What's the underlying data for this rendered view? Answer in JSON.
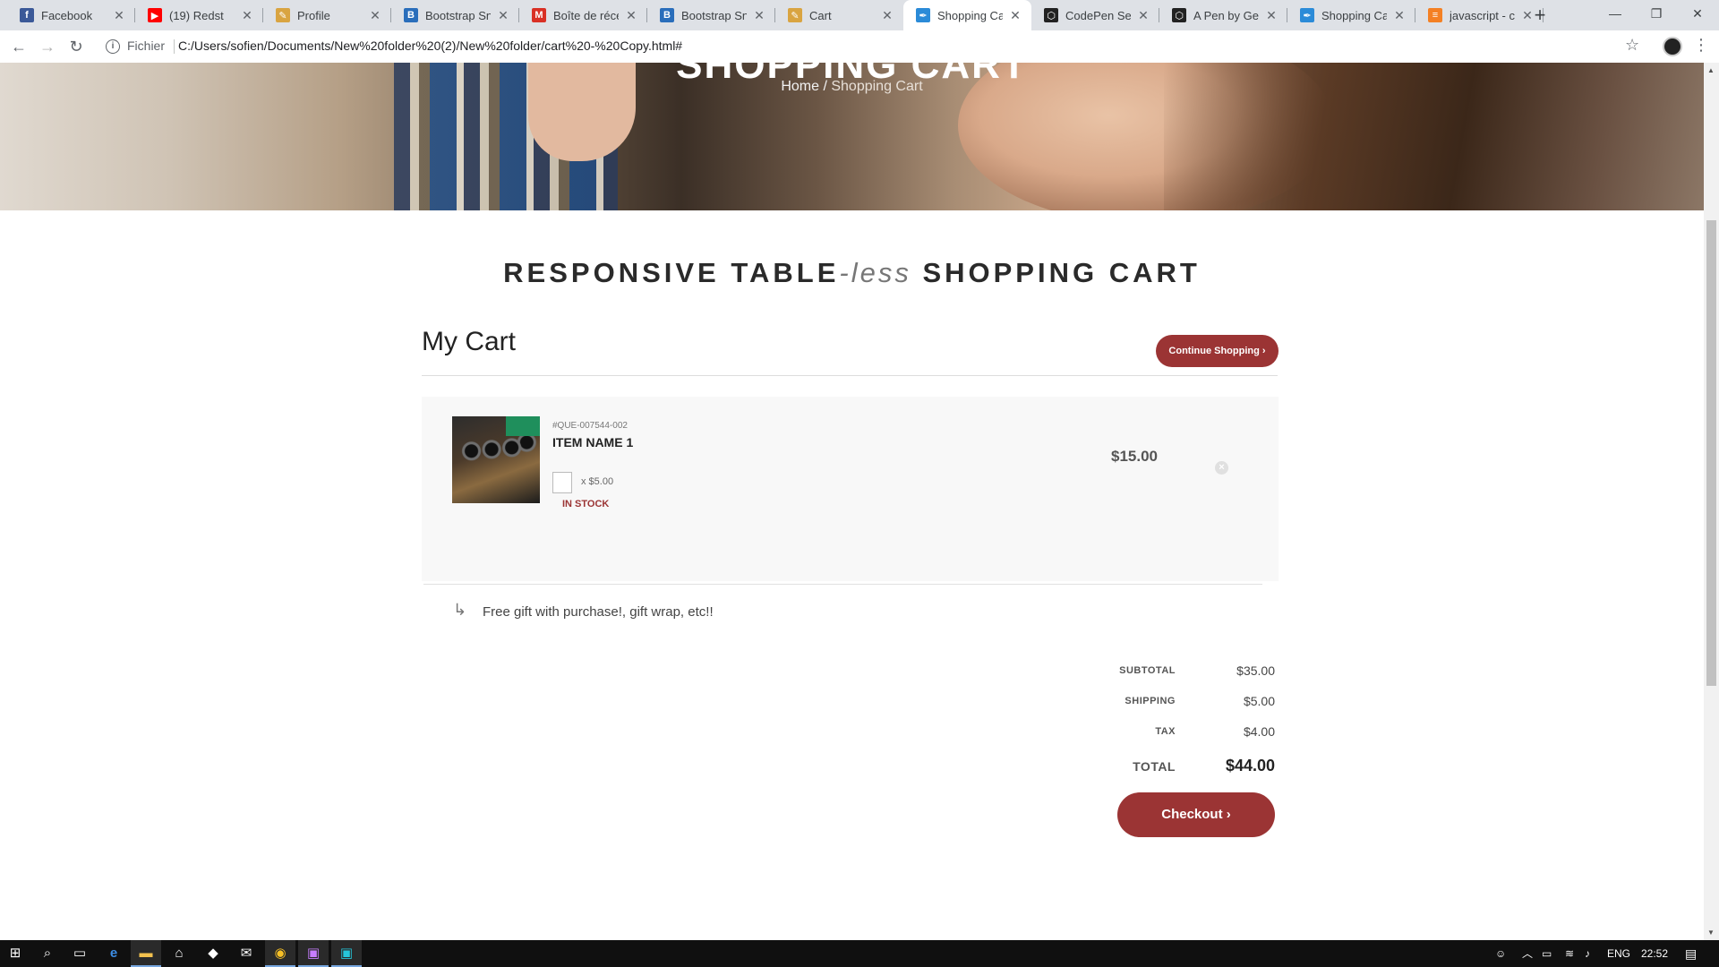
{
  "browser": {
    "tabs": [
      {
        "title": "Facebook",
        "favicon": "facebook-icon",
        "color": "#3b5998",
        "glyph": "f"
      },
      {
        "title": "(19) Redst",
        "favicon": "youtube-icon",
        "color": "#ff0000",
        "glyph": "▶"
      },
      {
        "title": "Profile",
        "favicon": "codepen-icon",
        "color": "#d9a441",
        "glyph": "✎"
      },
      {
        "title": "Bootstrap Snip",
        "favicon": "bootstrap-snippet-icon",
        "color": "#2a6ebb",
        "glyph": "B"
      },
      {
        "title": "Boîte de récep",
        "favicon": "gmail-icon",
        "color": "#d93025",
        "glyph": "M"
      },
      {
        "title": "Bootstrap Snip",
        "favicon": "bootstrap-snippet-icon",
        "color": "#2a6ebb",
        "glyph": "B"
      },
      {
        "title": "Cart",
        "favicon": "codepen-icon",
        "color": "#d9a441",
        "glyph": "✎"
      },
      {
        "title": "Shopping Cart",
        "favicon": "feather-icon",
        "color": "#2b8bd8",
        "glyph": "✒"
      },
      {
        "title": "CodePen Sear",
        "favicon": "codepen-logo-icon",
        "color": "#222222",
        "glyph": "⬡"
      },
      {
        "title": "A Pen by Geo",
        "favicon": "codepen-logo-icon",
        "color": "#222222",
        "glyph": "⬡"
      },
      {
        "title": "Shopping Cart",
        "favicon": "feather-icon",
        "color": "#2b8bd8",
        "glyph": "✒"
      },
      {
        "title": "javascript - ch",
        "favicon": "stackoverflow-icon",
        "color": "#f48024",
        "glyph": "≡"
      }
    ],
    "active_tab_index": 7,
    "address": {
      "scheme_label": "Fichier",
      "url": "C:/Users/sofien/Documents/New%20folder%20(2)/New%20folder/cart%20-%20Copy.html#"
    }
  },
  "hero": {
    "title": "SHOPPING CART",
    "breadcrumb_home": "Home",
    "breadcrumb_sep": " / ",
    "breadcrumb_current": "Shopping Cart"
  },
  "page": {
    "heading_part1": "RESPONSIVE TABLE",
    "heading_italic": "-less",
    "heading_part2": "SHOPPING CART",
    "cart_title": "My Cart",
    "continue_label": "Continue Shopping",
    "accent_color": "#9b3434"
  },
  "cart_item": {
    "sku": "#QUE-007544-002",
    "name": "ITEM NAME 1",
    "qty_value": "",
    "unit_price": "x $5.00",
    "stock": "IN STOCK",
    "price": "$15.00",
    "note": "Free gift with purchase!, gift wrap, etc!!"
  },
  "totals": {
    "subtotal_label": "SUBTOTAL",
    "subtotal": "$35.00",
    "shipping_label": "SHIPPING",
    "shipping": "$5.00",
    "tax_label": "TAX",
    "tax": "$4.00",
    "total_label": "TOTAL",
    "total": "$44.00",
    "checkout_label": "Checkout"
  },
  "taskbar": {
    "language": "ENG",
    "time": "22:52"
  }
}
